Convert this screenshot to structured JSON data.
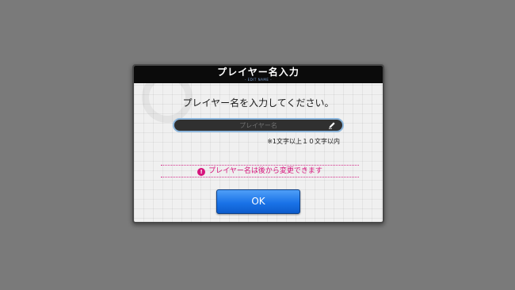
{
  "dialog": {
    "title": "プレイヤー名入力",
    "subtitle": "- EDIT NAME -",
    "prompt": "プレイヤー名を入力してください。",
    "input": {
      "placeholder": "プレイヤー名",
      "value": "",
      "icon": "pencil-icon"
    },
    "limit_note": "※1文字以上１０文字以内",
    "notice": {
      "icon": "alert-icon",
      "icon_glyph": "!",
      "text": "プレイヤー名は後から変更できます",
      "color": "#d6147c"
    },
    "ok_label": "OK",
    "accent": "#1a73e8"
  }
}
